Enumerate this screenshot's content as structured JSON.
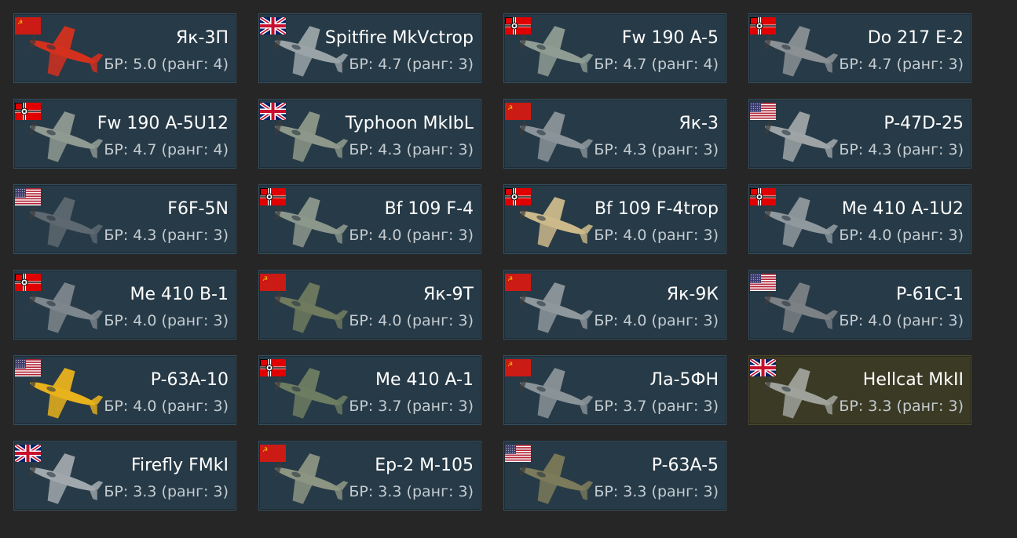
{
  "vehicles": [
    {
      "name": "Як-3П",
      "br": "БР: 5.0 (ранг: 4)",
      "nation": "ussr",
      "plane_color": "#d4301e"
    },
    {
      "name": "Spitfire MkVctrop",
      "br": "БР: 4.7 (ранг: 3)",
      "nation": "uk",
      "plane_color": "#9aa4a8"
    },
    {
      "name": "Fw 190 A-5",
      "br": "БР: 4.7 (ранг: 4)",
      "nation": "germany",
      "plane_color": "#8e9c93"
    },
    {
      "name": "Do 217 E-2",
      "br": "БР: 4.7 (ранг: 3)",
      "nation": "germany",
      "plane_color": "#8a9094"
    },
    {
      "name": "Fw 190 A-5U12",
      "br": "БР: 4.7 (ранг: 4)",
      "nation": "germany",
      "plane_color": "#8e9a92"
    },
    {
      "name": "Typhoon MkIbL",
      "br": "БР: 4.3 (ранг: 3)",
      "nation": "uk",
      "plane_color": "#8d988a"
    },
    {
      "name": "Як-3",
      "br": "БР: 4.3 (ранг: 3)",
      "nation": "ussr",
      "plane_color": "#8a9399"
    },
    {
      "name": "P-47D-25",
      "br": "БР: 4.3 (ранг: 3)",
      "nation": "usa",
      "plane_color": "#9ea4a6"
    },
    {
      "name": "F6F-5N",
      "br": "БР: 4.3 (ранг: 3)",
      "nation": "usa",
      "plane_color": "#5d6870"
    },
    {
      "name": "Bf 109 F-4",
      "br": "БР: 4.0 (ранг: 3)",
      "nation": "germany",
      "plane_color": "#8c978c"
    },
    {
      "name": "Bf 109 F-4trop",
      "br": "БР: 4.0 (ранг: 3)",
      "nation": "germany",
      "plane_color": "#cbb98a"
    },
    {
      "name": "Me 410 A-1U2",
      "br": "БР: 4.0 (ранг: 3)",
      "nation": "germany",
      "plane_color": "#8f989d"
    },
    {
      "name": "Me 410 B-1",
      "br": "БР: 4.0 (ранг: 3)",
      "nation": "germany",
      "plane_color": "#7d868c"
    },
    {
      "name": "Як-9Т",
      "br": "БР: 4.0 (ранг: 3)",
      "nation": "ussr",
      "plane_color": "#6f7a5e"
    },
    {
      "name": "Як-9К",
      "br": "БР: 4.0 (ранг: 3)",
      "nation": "ussr",
      "plane_color": "#8e979c"
    },
    {
      "name": "P-61C-1",
      "br": "БР: 4.0 (ранг: 3)",
      "nation": "usa",
      "plane_color": "#7b8185"
    },
    {
      "name": "P-63A-10",
      "br": "БР: 4.0 (ранг: 3)",
      "nation": "usa",
      "plane_color": "#e8b21c"
    },
    {
      "name": "Me 410 A-1",
      "br": "БР: 3.7 (ранг: 3)",
      "nation": "germany",
      "plane_color": "#6d7d62"
    },
    {
      "name": "Ла-5ФН",
      "br": "БР: 3.7 (ранг: 3)",
      "nation": "ussr",
      "plane_color": "#8a9398"
    },
    {
      "name": "Hellcat MkII",
      "br": "БР: 3.3 (ранг: 3)",
      "nation": "uk",
      "plane_color": "#9fa29a",
      "premium": true
    },
    {
      "name": "Firefly FMkI",
      "br": "БР: 3.3 (ранг: 3)",
      "nation": "uk",
      "plane_color": "#a0a8ad"
    },
    {
      "name": "Ер-2 М-105",
      "br": "БР: 3.3 (ранг: 3)",
      "nation": "ussr",
      "plane_color": "#8c9482"
    },
    {
      "name": "P-63A-5",
      "br": "БР: 3.3 (ранг: 3)",
      "nation": "usa",
      "plane_color": "#7b7a5a"
    }
  ]
}
